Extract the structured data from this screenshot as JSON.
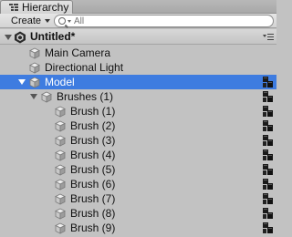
{
  "panel": {
    "tab_label": "Hierarchy",
    "tab_icon": "hierarchy-list-icon"
  },
  "toolbar": {
    "create_label": "Create",
    "search_placeholder": "All"
  },
  "scene": {
    "name": "Untitled*",
    "icon": "unity-logo-icon"
  },
  "colors": {
    "selection": "#3e7ce0",
    "panel_bg": "#c2c2c2"
  },
  "tree": [
    {
      "label": "Main Camera",
      "selected": false,
      "prefab": false
    },
    {
      "label": "Directional Light",
      "selected": false,
      "prefab": false
    },
    {
      "label": "Model",
      "selected": true,
      "prefab": true
    },
    {
      "label": "Brushes (1)",
      "selected": false,
      "prefab": true
    },
    {
      "label": "Brush (1)",
      "selected": false,
      "prefab": true
    },
    {
      "label": "Brush (2)",
      "selected": false,
      "prefab": true
    },
    {
      "label": "Brush (3)",
      "selected": false,
      "prefab": true
    },
    {
      "label": "Brush (4)",
      "selected": false,
      "prefab": true
    },
    {
      "label": "Brush (5)",
      "selected": false,
      "prefab": true
    },
    {
      "label": "Brush (6)",
      "selected": false,
      "prefab": true
    },
    {
      "label": "Brush (7)",
      "selected": false,
      "prefab": true
    },
    {
      "label": "Brush (8)",
      "selected": false,
      "prefab": true
    },
    {
      "label": "Brush (9)",
      "selected": false,
      "prefab": true
    }
  ]
}
